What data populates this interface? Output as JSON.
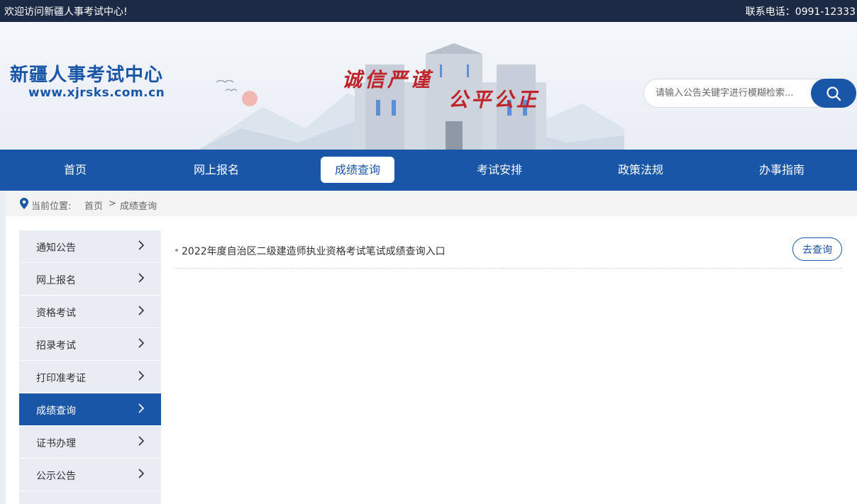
{
  "topbar": {
    "welcome": "欢迎访问新疆人事考试中心!",
    "phone": "联系电话：0991-12333"
  },
  "header": {
    "title": "新疆人事考试中心",
    "url": "www.xjrsks.com.cn",
    "slogan_left": "诚信严谨",
    "slogan_right": "公平公正"
  },
  "search": {
    "placeholder": "请输入公告关键字进行模糊检索..."
  },
  "nav": {
    "items": [
      "首页",
      "网上报名",
      "成绩查询",
      "考试安排",
      "政策法规",
      "办事指南"
    ],
    "active": "成绩查询"
  },
  "breadcrumb": {
    "label": "当前位置:",
    "home": "首页",
    "separator": ">",
    "current": "成绩查询"
  },
  "sidebar": {
    "items": [
      "通知公告",
      "网上报名",
      "资格考试",
      "招录考试",
      "打印准考证",
      "成绩查询",
      "证书办理",
      "公示公告"
    ],
    "active": "成绩查询"
  },
  "content": {
    "entries": [
      {
        "title": "2022年度自治区二级建造师执业资格考试笔试成绩查询入口",
        "button": "去查询"
      }
    ]
  },
  "colors": {
    "brand_blue": "#1a56a8",
    "topbar_bg": "#1c2a45",
    "slogan_red": "#c0242b"
  }
}
